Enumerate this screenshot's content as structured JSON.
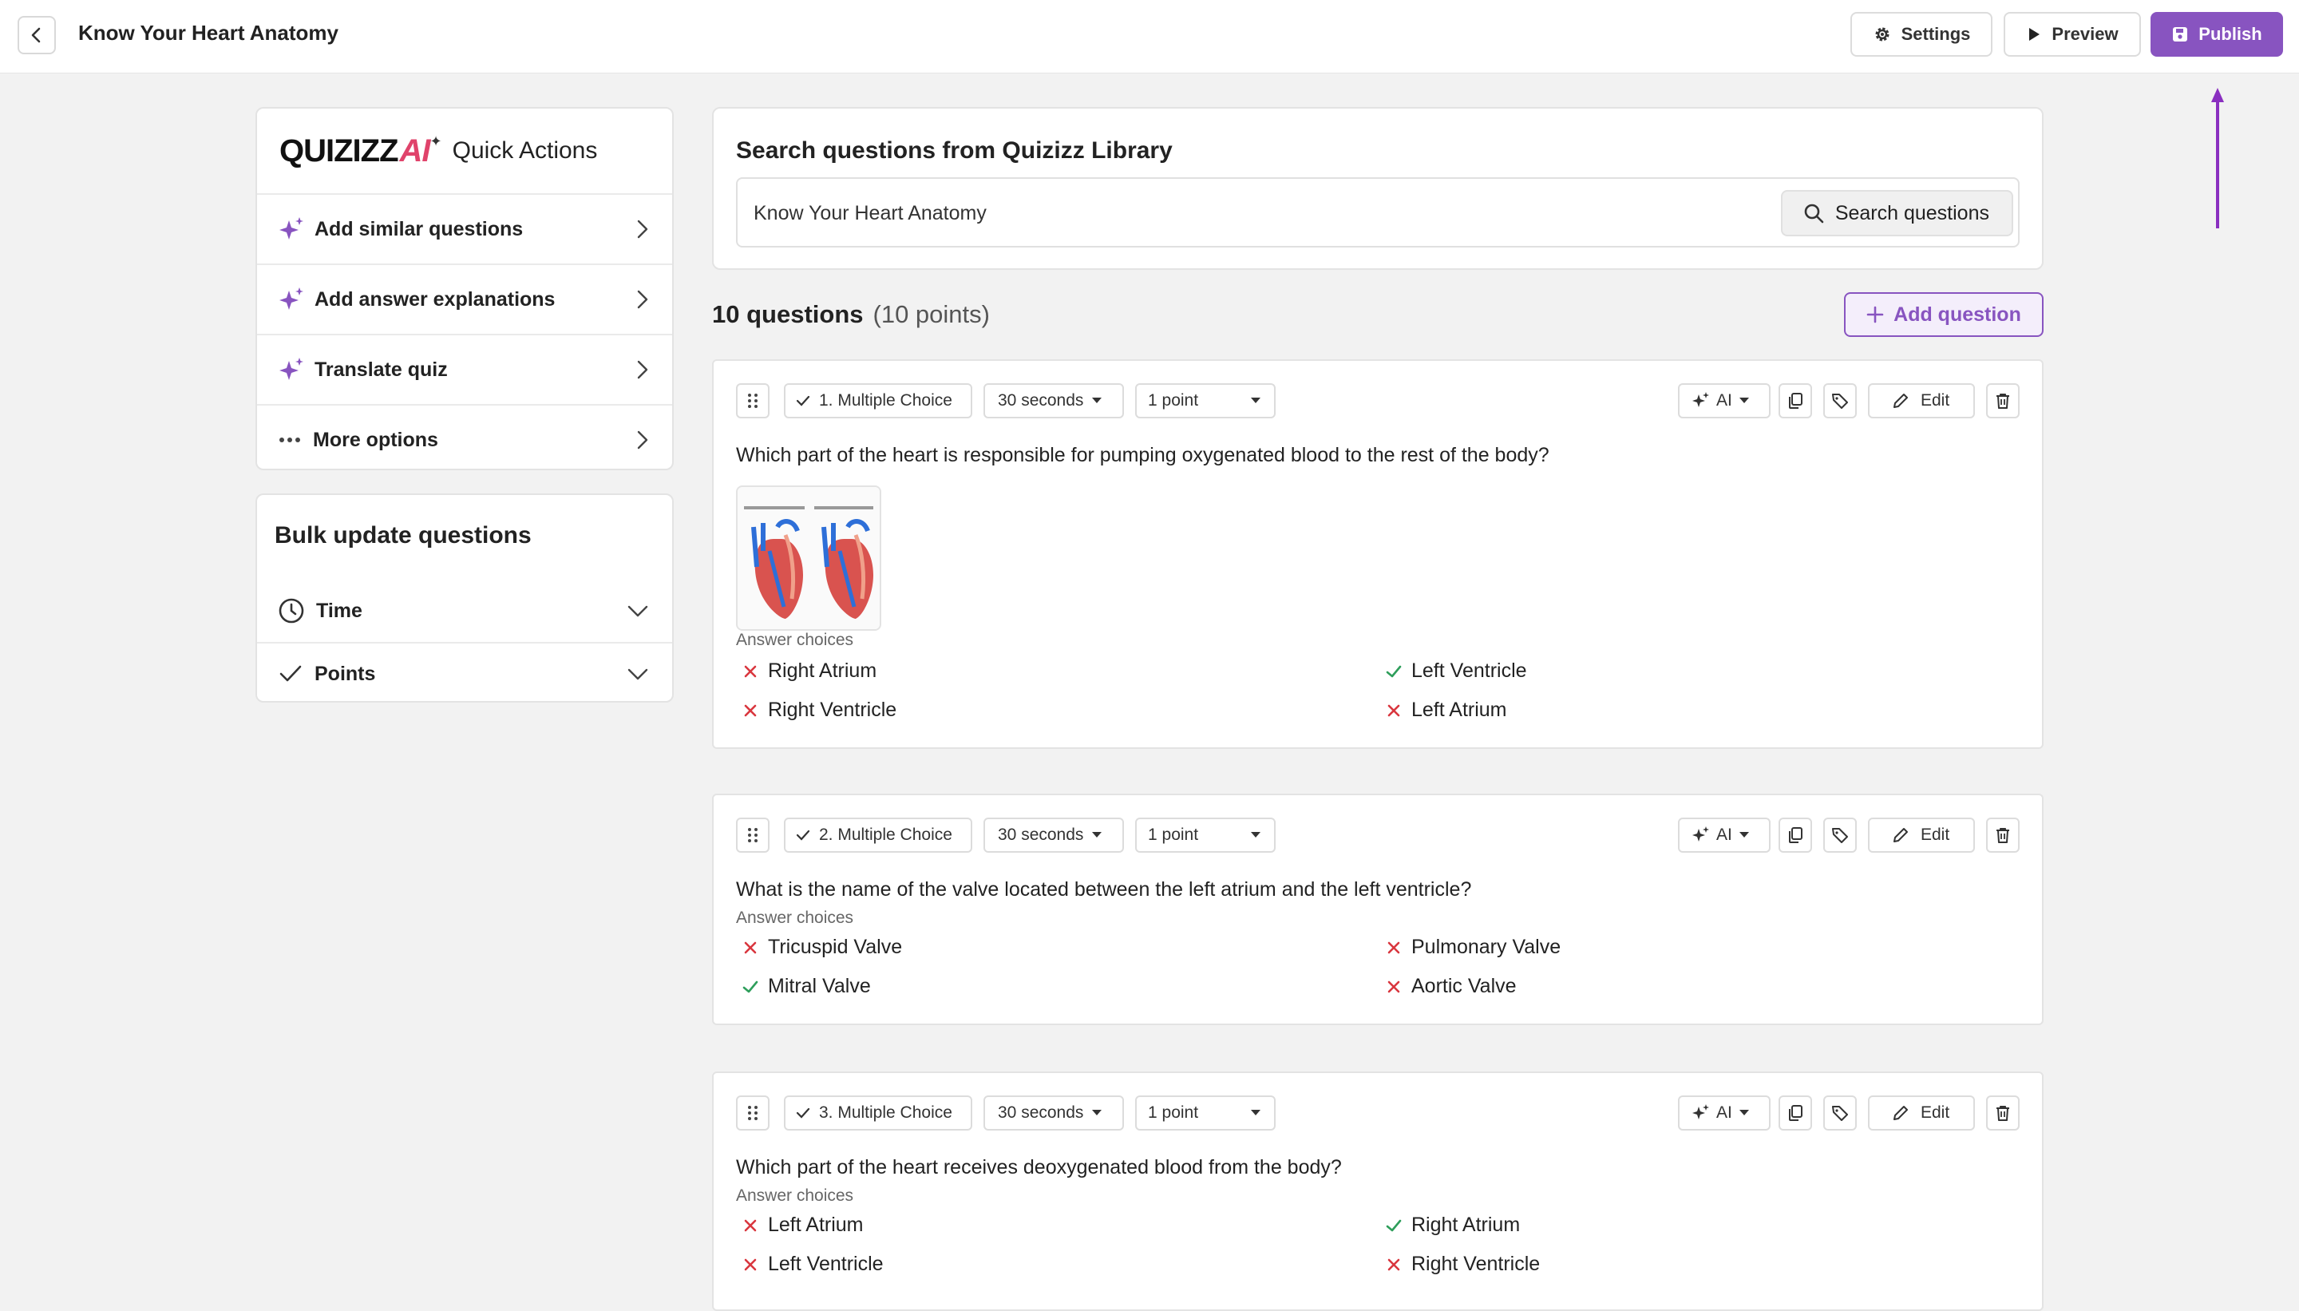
{
  "header": {
    "title": "Know Your Heart Anatomy",
    "settings_label": "Settings",
    "preview_label": "Preview",
    "publish_label": "Publish"
  },
  "quick_actions": {
    "brand_main": "QUIZIZZ",
    "brand_ai": "AI",
    "title": "Quick Actions",
    "items": [
      {
        "label": "Add similar questions",
        "icon": "sparkle-icon"
      },
      {
        "label": "Add answer explanations",
        "icon": "sparkle-icon"
      },
      {
        "label": "Translate quiz",
        "icon": "sparkle-icon"
      },
      {
        "label": "More options",
        "icon": "more-dots-icon"
      }
    ]
  },
  "bulk_update": {
    "title": "Bulk update questions",
    "items": [
      {
        "label": "Time",
        "icon": "clock-icon"
      },
      {
        "label": "Points",
        "icon": "check-icon"
      }
    ]
  },
  "search": {
    "heading": "Search questions from Quizizz Library",
    "value": "Know Your Heart Anatomy",
    "button_label": "Search questions"
  },
  "summary": {
    "count": "10 questions",
    "points": "(10 points)",
    "add_label": "Add question"
  },
  "questions": [
    {
      "type": "1. Multiple Choice",
      "time": "30 seconds",
      "points": "1 point",
      "ai_label": "AI",
      "edit_label": "Edit",
      "text": "Which part of the heart is responsible for pumping oxygenated blood to the rest of the body?",
      "has_image": true,
      "answers_label": "Answer choices",
      "answers": [
        {
          "text": "Right Atrium",
          "correct": false
        },
        {
          "text": "Left Ventricle",
          "correct": true
        },
        {
          "text": "Right Ventricle",
          "correct": false
        },
        {
          "text": "Left Atrium",
          "correct": false
        }
      ]
    },
    {
      "type": "2. Multiple Choice",
      "time": "30 seconds",
      "points": "1 point",
      "ai_label": "AI",
      "edit_label": "Edit",
      "text": "What is the name of the valve located between the left atrium and the left ventricle?",
      "answers_label": "Answer choices",
      "answers": [
        {
          "text": "Tricuspid Valve",
          "correct": false
        },
        {
          "text": "Pulmonary Valve",
          "correct": false
        },
        {
          "text": "Mitral Valve",
          "correct": true
        },
        {
          "text": "Aortic Valve",
          "correct": false
        }
      ]
    },
    {
      "type": "3. Multiple Choice",
      "time": "30 seconds",
      "points": "1 point",
      "ai_label": "AI",
      "edit_label": "Edit",
      "text": "Which part of the heart receives deoxygenated blood from the body?",
      "answers_label": "Answer choices",
      "answers": [
        {
          "text": "Left Atrium",
          "correct": false
        },
        {
          "text": "Right Atrium",
          "correct": true
        },
        {
          "text": "Left Ventricle",
          "correct": false
        },
        {
          "text": "Right Ventricle",
          "correct": false
        }
      ]
    }
  ],
  "colors": {
    "accent": "#8854c0",
    "correct": "#2e9e5b",
    "incorrect": "#d9363e"
  }
}
